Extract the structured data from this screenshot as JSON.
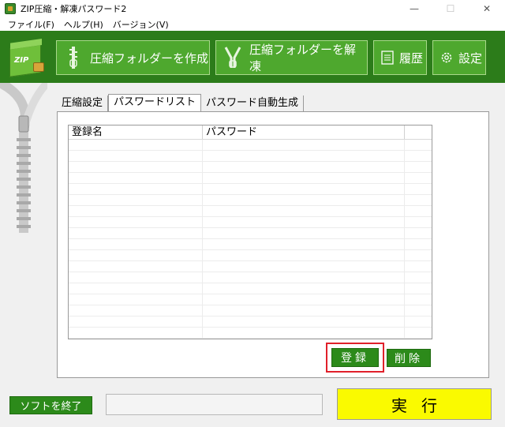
{
  "window": {
    "title": "ZIP圧縮・解凍パスワード2",
    "minimize": "—",
    "maximize": "☐",
    "close": "✕"
  },
  "menu": [
    "ファイル(F)",
    "ヘルプ(H)",
    "バージョン(V)"
  ],
  "toolbar": {
    "logo_text": "ZIP",
    "create_label": "圧縮フォルダーを作成",
    "extract_label": "圧縮フォルダーを解凍",
    "history_label": "履歴",
    "settings_label": "設定"
  },
  "tabs": [
    "圧縮設定",
    "パスワードリスト",
    "パスワード自動生成"
  ],
  "active_tab": "パスワードリスト",
  "list": {
    "columns": [
      "登録名",
      "パスワード",
      ""
    ],
    "rows": []
  },
  "buttons": {
    "register": "登録",
    "delete": "削除",
    "quit": "ソフトを終了",
    "execute": "実行"
  },
  "status_text": "",
  "colors": {
    "toolbar_bg": "#2c7c1a",
    "toolbar_button": "#4ea82e",
    "green_button": "#2c8a1a",
    "execute_button": "#fafa00",
    "highlight": "#e0202a"
  }
}
